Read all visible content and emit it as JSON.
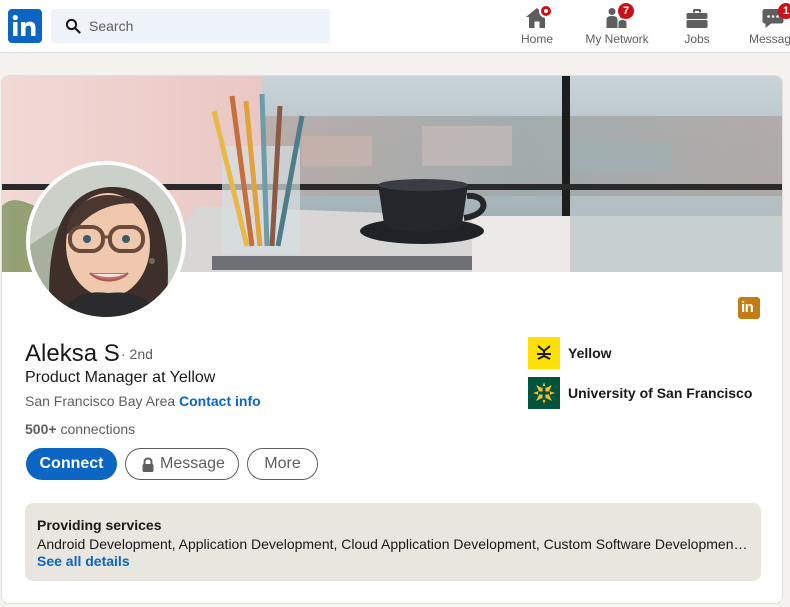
{
  "nav": {
    "search_placeholder": "Search",
    "items": [
      {
        "label": "Home",
        "icon": "home-icon"
      },
      {
        "label": "My Network",
        "icon": "network-icon",
        "badge": "7"
      },
      {
        "label": "Jobs",
        "icon": "briefcase-icon"
      },
      {
        "label": "Messaging",
        "icon": "messaging-icon",
        "badge": "1"
      }
    ]
  },
  "profile": {
    "name": "Aleksa S",
    "degree": "· 2nd",
    "headline": "Product Manager at Yellow",
    "location": "San Francisco Bay Area",
    "separator": "·",
    "contact_label": "Contact info",
    "connections_count": "500+",
    "connections_label": "connections",
    "badge_text": "in"
  },
  "actions": {
    "connect_label": "Connect",
    "message_label": "Message",
    "more_label": "More"
  },
  "experience": [
    {
      "name": "Yellow",
      "logo": "yellow-company-logo"
    },
    {
      "name": "University of San Francisco",
      "logo": "usf-logo"
    }
  ],
  "services": {
    "title": "Providing services",
    "list": "Android Development, Application Development, Cloud Application Development, Custom Software Development, Mobile Application Development",
    "link": "See all details"
  },
  "colors": {
    "brand": "#0a66c2",
    "badge_red": "#cc1016",
    "premium_gold": "#c37d16",
    "yellow_brand": "#ffe100",
    "usf_green": "#00543c"
  }
}
